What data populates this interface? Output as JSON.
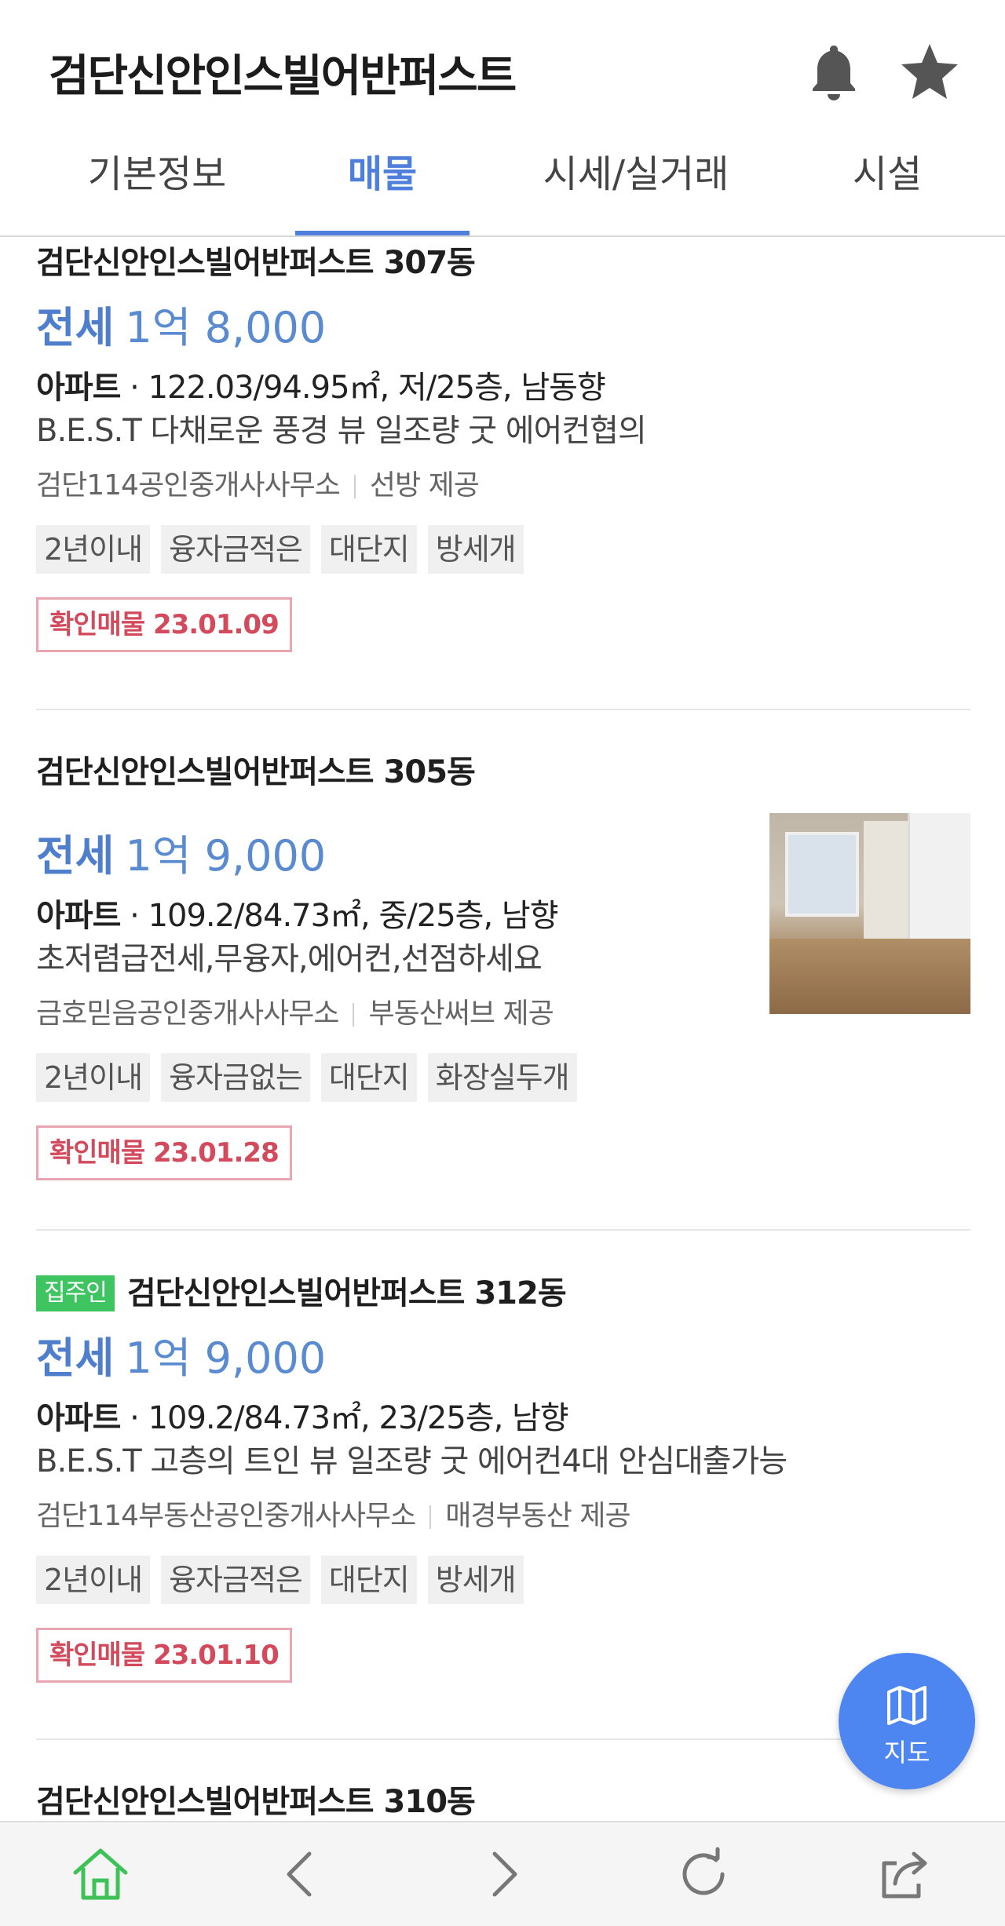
{
  "header": {
    "title": "검단신안인스빌어반퍼스트"
  },
  "tabs": [
    {
      "label": "기본정보",
      "active": false
    },
    {
      "label": "매물",
      "active": true
    },
    {
      "label": "시세/실거래",
      "active": false
    },
    {
      "label": "시설",
      "active": false
    }
  ],
  "listings": [
    {
      "title": "검단신안인스빌어반퍼스트 307동",
      "deal_type": "전세",
      "price": "1억 8,000",
      "property_type": "아파트",
      "spec": "122.03/94.95㎡, 저/25층, 남동향",
      "description": "B.E.S.T 다채로운 풍경 뷰 일조량 굿 에어컨협의",
      "agency": "검단114공인중개사사무소",
      "provider": "선방 제공",
      "tags": [
        "2년이내",
        "융자금적은",
        "대단지",
        "방세개"
      ],
      "verified": "확인매물 23.01.09"
    },
    {
      "title": "검단신안인스빌어반퍼스트 305동",
      "deal_type": "전세",
      "price": "1억 9,000",
      "property_type": "아파트",
      "spec": "109.2/84.73㎡, 중/25층, 남향",
      "description": "초저렴급전세,무융자,에어컨,선점하세요",
      "agency": "금호믿음공인중개사사무소",
      "provider": "부동산써브 제공",
      "tags": [
        "2년이내",
        "융자금없는",
        "대단지",
        "화장실두개"
      ],
      "verified": "확인매물 23.01.28"
    },
    {
      "owner_badge": "집주인",
      "title": "검단신안인스빌어반퍼스트 312동",
      "deal_type": "전세",
      "price": "1억 9,000",
      "property_type": "아파트",
      "spec": "109.2/84.73㎡, 23/25층, 남향",
      "description": "B.E.S.T 고층의 트인 뷰 일조량 굿 에어컨4대 안심대출가능",
      "agency": "검단114부동산공인중개사사무소",
      "provider": "매경부동산 제공",
      "tags": [
        "2년이내",
        "융자금적은",
        "대단지",
        "방세개"
      ],
      "verified": "확인매물 23.01.10"
    },
    {
      "title": "검단신안인스빌어반퍼스트 310동"
    }
  ],
  "fab": {
    "label": "지도",
    "icon": "map-icon"
  },
  "bottom_nav": [
    "home-icon",
    "back-icon",
    "forward-icon",
    "refresh-icon",
    "share-icon"
  ],
  "colors": {
    "accent": "#4f7fdc",
    "verified": "#d24a5c",
    "owner_badge": "#3fc462",
    "fab": "#4d86f0"
  }
}
